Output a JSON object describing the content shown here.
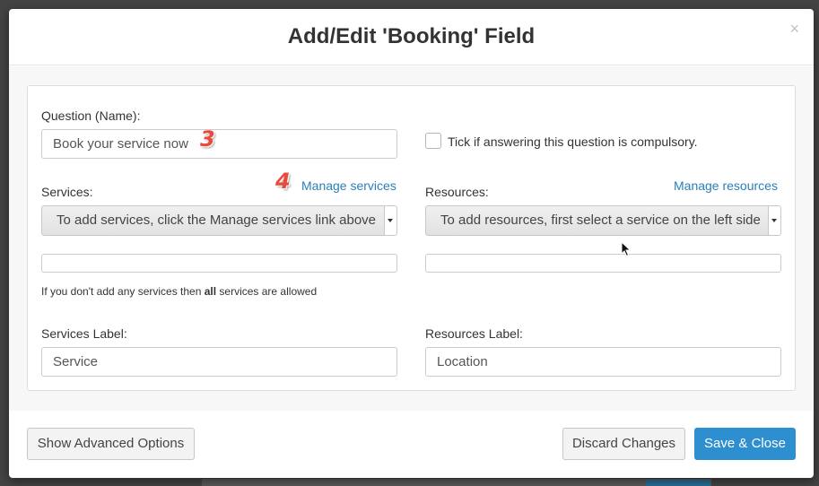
{
  "modal": {
    "title": "Add/Edit 'Booking' Field",
    "close_glyph": "×"
  },
  "question": {
    "label": "Question (Name):",
    "value": "Book your service now",
    "annotation_number": "3"
  },
  "compulsory": {
    "label": "Tick if answering this question is compulsory.",
    "checked": false
  },
  "services": {
    "label": "Services:",
    "manage_link": "Manage services",
    "annotation_number": "4",
    "select_value": "To add services, click the Manage services link above",
    "note_prefix": "If you don't add any services then ",
    "note_bold": "all",
    "note_suffix": " services are allowed"
  },
  "resources": {
    "label": "Resources:",
    "manage_link": "Manage resources",
    "select_value": "To add resources, first select a service on the left side"
  },
  "services_label": {
    "label": "Services Label:",
    "value": "Service"
  },
  "resources_label": {
    "label": "Resources Label:",
    "value": "Location"
  },
  "footer": {
    "advanced_button": "Show Advanced Options",
    "discard_button": "Discard Changes",
    "save_button": "Save & Close"
  },
  "colors": {
    "primary": "#2e8fd0",
    "link": "#2a7fb8",
    "annotation": "#e84a3c"
  }
}
